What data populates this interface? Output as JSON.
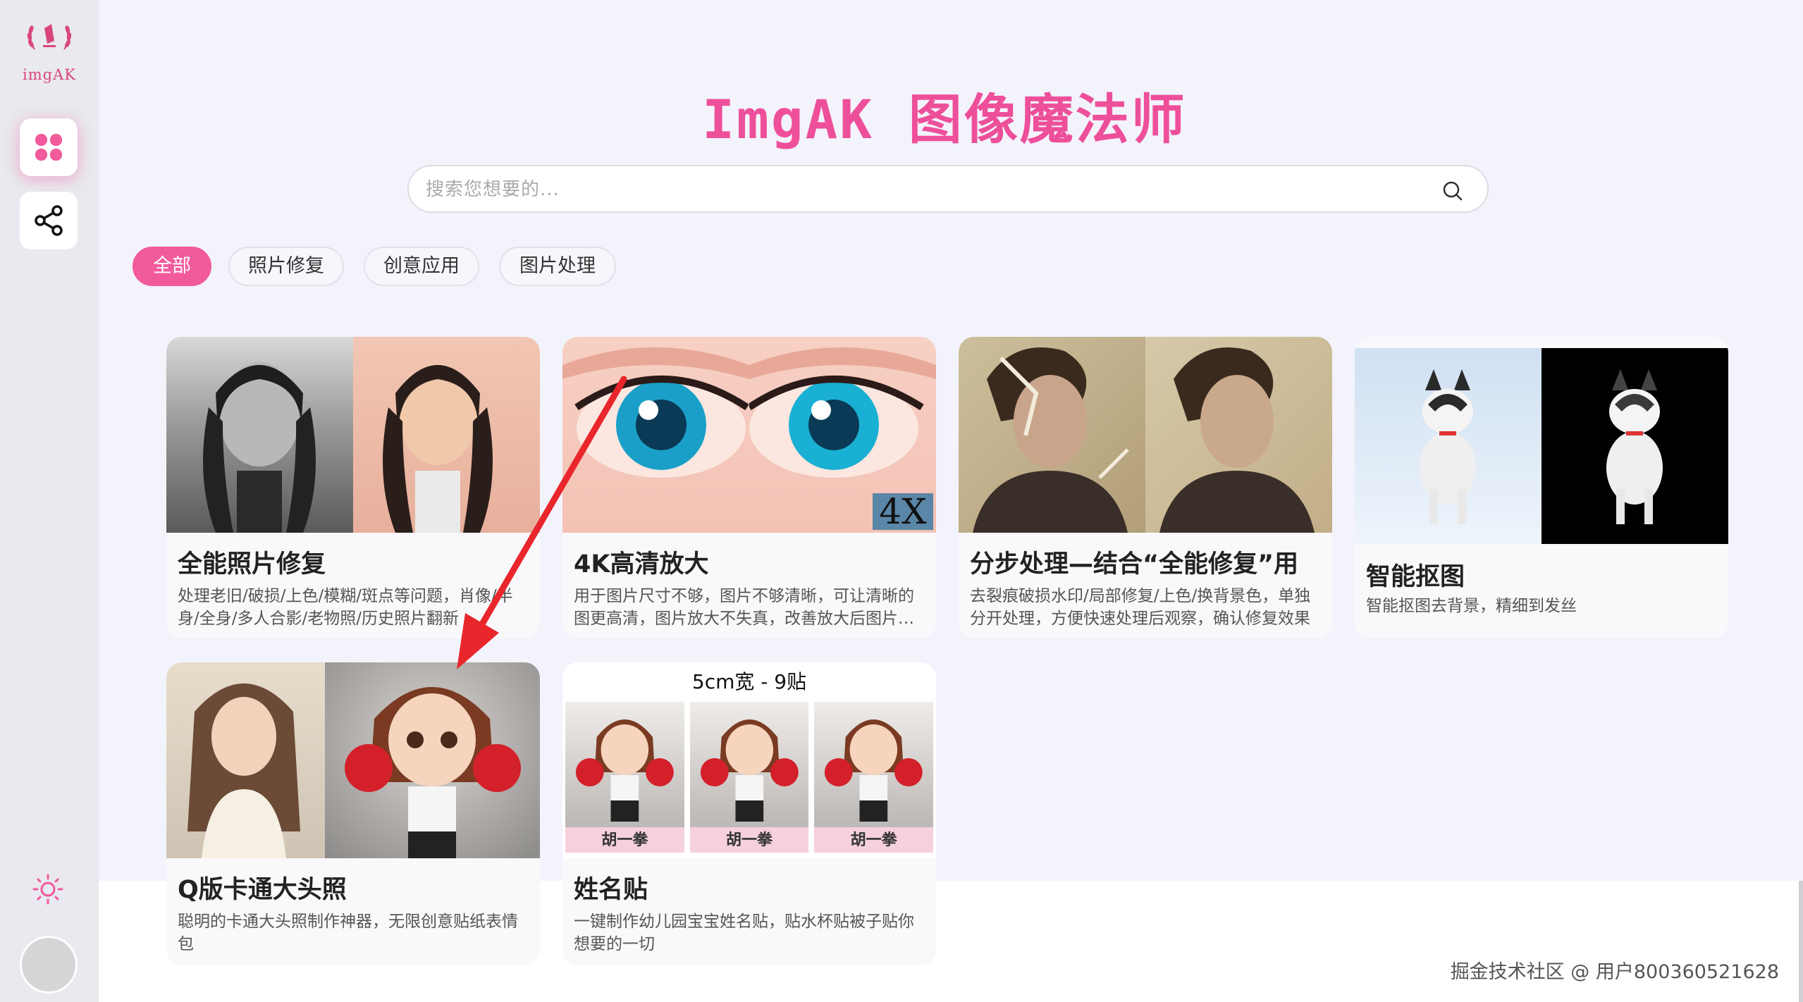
{
  "app": {
    "logo_text": "imgAK",
    "title": "ImgAK 图像魔法师"
  },
  "search": {
    "placeholder": "搜索您想要的..."
  },
  "filters": [
    {
      "label": "全部",
      "active": true
    },
    {
      "label": "照片修复",
      "active": false
    },
    {
      "label": "创意应用",
      "active": false
    },
    {
      "label": "图片处理",
      "active": false
    }
  ],
  "cards": [
    {
      "title": "全能照片修复",
      "desc": "处理老旧/破损/上色/模糊/斑点等问题，肖像/半身/全身/多人合影/老物照/历史照片翻新"
    },
    {
      "title": "4K高清放大",
      "desc": "用于图片尺寸不够，图片不够清晰，可让清晰的图更高清，图片放大不失真，改善放大后图片质量",
      "badge": "4X"
    },
    {
      "title": "分步处理—结合“全能修复”用",
      "desc": "去裂痕破损水印/局部修复/上色/换背景色，单独分开处理，方便快速处理后观察，确认修复效果"
    },
    {
      "title": "智能抠图",
      "desc": "智能抠图去背景，精细到发丝"
    },
    {
      "title": "Q版卡通大头照",
      "desc": "聪明的卡通大头照制作神器，无限创意贴纸表情包"
    },
    {
      "title": "姓名贴",
      "desc": "一键制作幼儿园宝宝姓名贴，贴水杯贴被子贴你想要的一切",
      "sticker_header": "5cm宽 - 9贴",
      "sticker_name": "胡一拳"
    }
  ],
  "watermark": "掘金技术社区 @ 用户800360521628",
  "colors": {
    "accent": "#f15a9b",
    "title": "#ee4f9a",
    "sidebar": "#e9e9ef",
    "main_bg": "#f3f3fc"
  }
}
